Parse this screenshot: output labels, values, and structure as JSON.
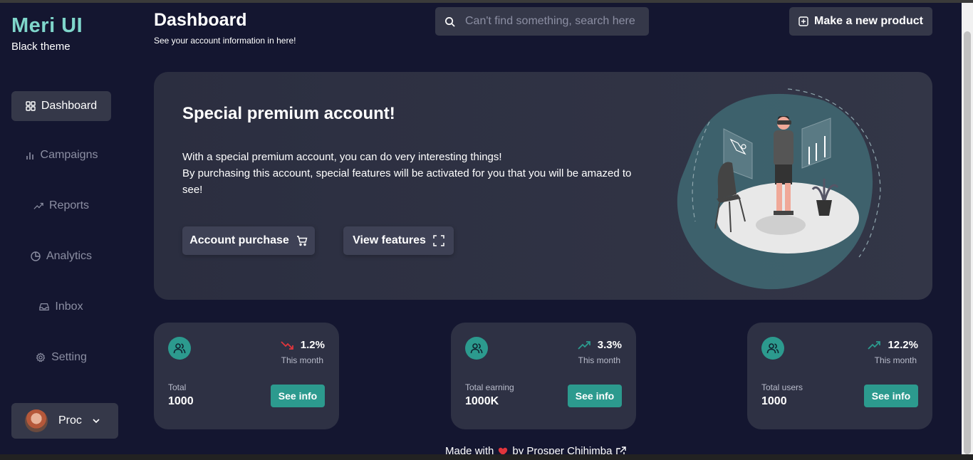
{
  "brand": {
    "name": "Meri UI",
    "subtitle": "Black theme"
  },
  "sidebar": {
    "items": [
      {
        "label": "Dashboard",
        "icon": "grid-icon",
        "active": true
      },
      {
        "label": "Campaigns",
        "icon": "bar-chart-icon"
      },
      {
        "label": "Reports",
        "icon": "trending-up-icon"
      },
      {
        "label": "Analytics",
        "icon": "pie-chart-icon"
      },
      {
        "label": "Inbox",
        "icon": "inbox-icon"
      },
      {
        "label": "Setting",
        "icon": "gear-icon"
      }
    ],
    "user": {
      "name": "Proc"
    }
  },
  "header": {
    "title": "Dashboard",
    "subtitle": "See your account information in here!",
    "search_placeholder": "Can't find something, search here",
    "new_product_label": "Make a new product"
  },
  "hero": {
    "title": "Special premium account!",
    "line1": "With a special premium account, you can do very interesting things!",
    "line2": "By purchasing this account, special features will be activated for you that you will be amazed to see!",
    "purchase_label": "Account purchase",
    "features_label": "View features"
  },
  "cards": [
    {
      "label": "Total",
      "value": "1000",
      "change": "1.2%",
      "direction": "down",
      "period": "This month",
      "button": "See info"
    },
    {
      "label": "Total earning",
      "value": "1000K",
      "change": "3.3%",
      "direction": "up",
      "period": "This month",
      "button": "See info"
    },
    {
      "label": "Total users",
      "value": "1000",
      "change": "12.2%",
      "direction": "up",
      "period": "This month",
      "button": "See info"
    }
  ],
  "footer": {
    "prefix": "Made with",
    "suffix": "by Prosper Chihimba"
  },
  "colors": {
    "accent": "#2c9a8e",
    "brand": "#7fd6cb",
    "down": "#e0353c",
    "background": "#141630",
    "card": "#2e3144"
  }
}
